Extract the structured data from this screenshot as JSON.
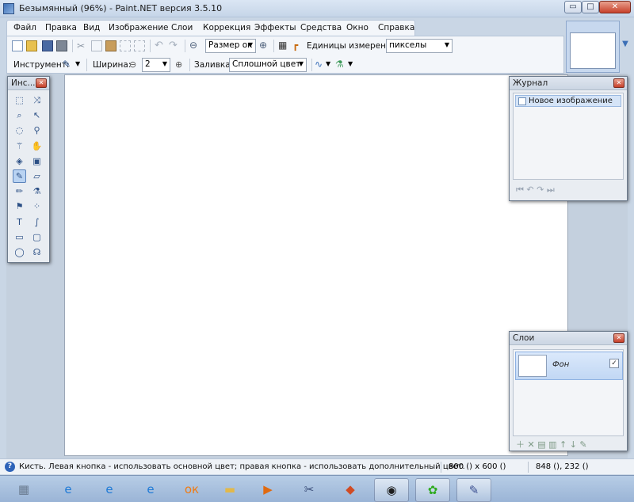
{
  "window": {
    "title": "Безымянный (96%) - Paint.NET версия 3.5.10",
    "controls": {
      "minimize": "▭",
      "maximize": "□",
      "close": "✕"
    }
  },
  "menu": {
    "items": [
      "Файл",
      "Правка",
      "Вид",
      "Изображение",
      "Слои",
      "Коррекция",
      "Эффекты",
      "Средства",
      "Окно",
      "Справка"
    ]
  },
  "toolbar": {
    "zoom_value": "Размер ок",
    "units_label": "Единицы измерения:",
    "units_value": "пикселы",
    "tool_label": "Инструмент:",
    "width_label": "Ширина:",
    "width_value": "2",
    "fill_label": "Заливка:",
    "fill_value": "Сплошной цвет",
    "width_minus": "⊖",
    "width_plus": "⊕"
  },
  "tools_panel": {
    "title": "Инс...",
    "active_tool": "brush",
    "tools": [
      {
        "icon": "rectangle-select-icon",
        "glyph": "⬚"
      },
      {
        "icon": "move-selection-icon",
        "glyph": "⤨"
      },
      {
        "icon": "lasso-select-icon",
        "glyph": "⌕"
      },
      {
        "icon": "move-selected-icon",
        "glyph": "↖"
      },
      {
        "icon": "ellipse-select-icon",
        "glyph": "◌"
      },
      {
        "icon": "zoom-icon",
        "glyph": "⚲"
      },
      {
        "icon": "magic-wand-icon",
        "glyph": "⚚"
      },
      {
        "icon": "pan-icon",
        "glyph": "✋"
      },
      {
        "icon": "paint-bucket-icon",
        "glyph": "◈"
      },
      {
        "icon": "gradient-icon",
        "glyph": "▣"
      },
      {
        "icon": "paintbrush-icon",
        "glyph": "✎"
      },
      {
        "icon": "eraser-icon",
        "glyph": "▱"
      },
      {
        "icon": "pencil-icon",
        "glyph": "✏"
      },
      {
        "icon": "color-picker-icon",
        "glyph": "⚗"
      },
      {
        "icon": "clone-stamp-icon",
        "glyph": "⚑"
      },
      {
        "icon": "recolor-icon",
        "glyph": "⁘"
      },
      {
        "icon": "text-icon",
        "glyph": "T"
      },
      {
        "icon": "line-curve-icon",
        "glyph": "∫"
      },
      {
        "icon": "rectangle-icon",
        "glyph": "▭"
      },
      {
        "icon": "rounded-rectangle-icon",
        "glyph": "▢"
      },
      {
        "icon": "ellipse-icon",
        "glyph": "◯"
      },
      {
        "icon": "freeform-shape-icon",
        "glyph": "☊"
      }
    ]
  },
  "history_panel": {
    "title": "Журнал",
    "items": [
      "Новое изображение"
    ],
    "buttons": "⏮  ↶  ↷  ⏭"
  },
  "layers_panel": {
    "title": "Слои",
    "layers": [
      {
        "name": "Фон",
        "visible_mark": "✓"
      }
    ],
    "buttons": "＋ ✕ ▤ ▥ ↑ ↓ ✎"
  },
  "status": {
    "help_glyph": "?",
    "text": "Кисть. Левая кнопка - использовать основной цвет; правая кнопка - использовать дополнительный цвет.",
    "image_size": "800 () x 600 ()",
    "cursor_pos": "848 (), 232 ()"
  },
  "taskbar": {
    "items": [
      {
        "name": "calculator-task",
        "glyph": "▦",
        "color": "#6b7c91",
        "open": false
      },
      {
        "name": "internet-explorer-task",
        "glyph": "e",
        "color": "#1f7ad6",
        "open": false
      },
      {
        "name": "internet-explorer-task-2",
        "glyph": "e",
        "color": "#1f7ad6",
        "open": false
      },
      {
        "name": "internet-explorer-task-3",
        "glyph": "e",
        "color": "#1f7ad6",
        "open": false
      },
      {
        "name": "odnoklassniki-task",
        "glyph": "ок",
        "color": "#ef7b14",
        "open": false
      },
      {
        "name": "folder-task",
        "glyph": "▬",
        "color": "#e2b84a",
        "open": false
      },
      {
        "name": "media-player-task",
        "glyph": "▶",
        "color": "#e06a10",
        "open": false
      },
      {
        "name": "video-editor-task",
        "glyph": "✂",
        "color": "#3c4f7a",
        "open": false
      },
      {
        "name": "game-task",
        "glyph": "◆",
        "color": "#d04b24",
        "open": false
      },
      {
        "name": "asrock-task",
        "glyph": "◉",
        "color": "#1d1d1d",
        "open": true
      },
      {
        "name": "icq-task",
        "glyph": "✿",
        "color": "#2faa1f",
        "open": true
      },
      {
        "name": "paintnet-task",
        "glyph": "✎",
        "color": "#3b4f91",
        "open": true
      }
    ]
  }
}
